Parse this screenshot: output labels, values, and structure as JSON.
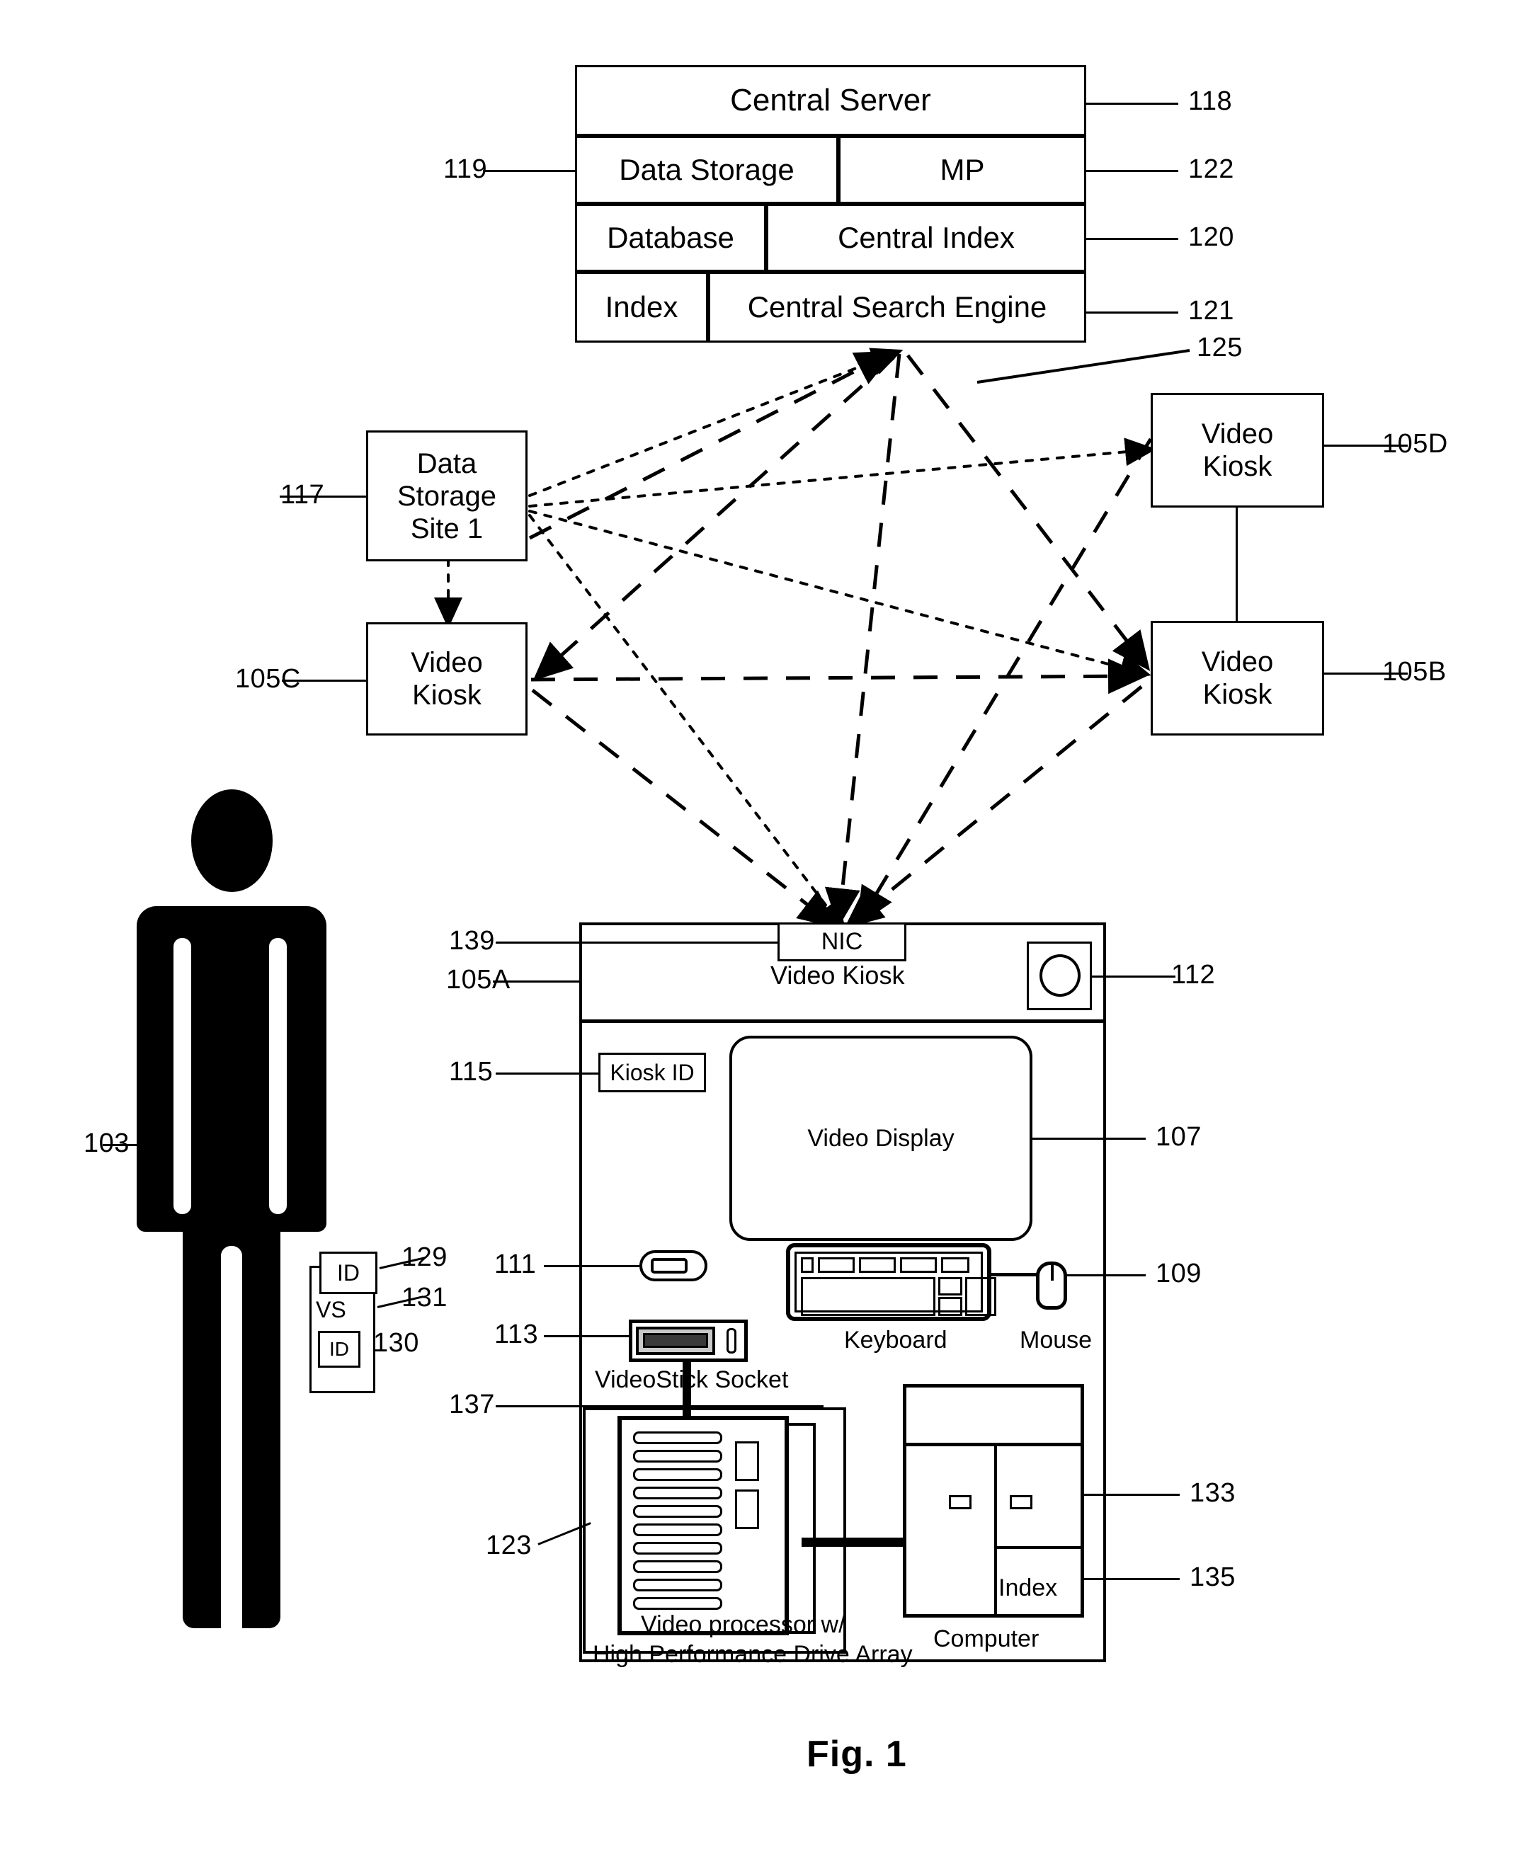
{
  "figure": {
    "caption": "Fig. 1"
  },
  "central_server": {
    "title": "Central Server",
    "ref_title": "118",
    "rows": [
      {
        "left": "Data Storage",
        "left_ref": "119",
        "right": "MP",
        "right_ref": "122"
      },
      {
        "left": "Database",
        "right": "Central Index",
        "right_ref": "120"
      },
      {
        "left": "Index",
        "right": "Central Search Engine",
        "right_ref": "121"
      }
    ]
  },
  "network": {
    "ref": "125",
    "data_storage_site": {
      "label": "Data Storage Site 1",
      "line1": "Data",
      "line2": "Storage",
      "line3": "Site 1",
      "ref": "117"
    },
    "kiosks": [
      {
        "label": "Video Kiosk",
        "line1": "Video",
        "line2": "Kiosk",
        "ref": "105C"
      },
      {
        "label": "Video Kiosk",
        "line1": "Video",
        "line2": "Kiosk",
        "ref": "105D"
      },
      {
        "label": "Video Kiosk",
        "line1": "Video",
        "line2": "Kiosk",
        "ref": "105B"
      }
    ]
  },
  "person": {
    "ref": "103",
    "badge_id_top": "ID",
    "badge_id_top_ref": "129",
    "badge_vs": "VS",
    "badge_vs_ref": "131",
    "badge_id_inner": "ID",
    "badge_id_inner_ref": "130"
  },
  "kiosk_panel": {
    "ref": "105A",
    "nic": {
      "label": "NIC",
      "ref": "139"
    },
    "title": "Video Kiosk",
    "camera_ref": "112",
    "kiosk_id": {
      "label": "Kiosk ID",
      "ref": "115"
    },
    "video_display": {
      "label": "Video Display",
      "ref": "107"
    },
    "card_slot_ref": "111",
    "videostick_socket": {
      "label": "VideoStick Socket",
      "ref": "113"
    },
    "keyboard": {
      "label": "Keyboard",
      "ref": "109"
    },
    "mouse": {
      "label": "Mouse"
    },
    "bus_ref": "137",
    "video_processor": {
      "line1": "Video processor w/",
      "line2": "High Performance Drive Array",
      "ref": "123"
    },
    "computer": {
      "label": "Computer",
      "ref": "133"
    },
    "index": {
      "label": "Index",
      "ref": "135"
    }
  }
}
